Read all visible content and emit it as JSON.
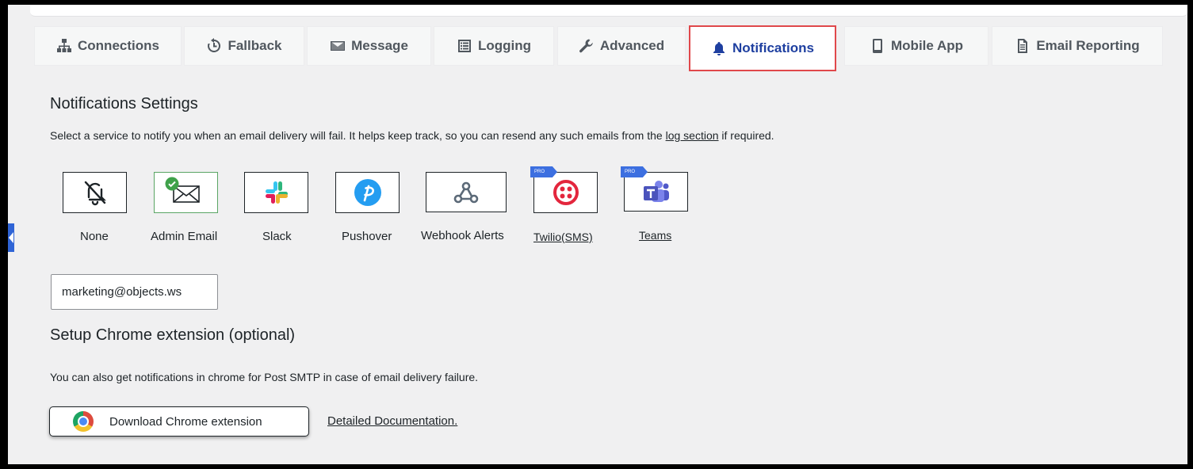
{
  "tabs": [
    {
      "label": "Connections",
      "icon": "sitemap-icon"
    },
    {
      "label": "Fallback",
      "icon": "history-icon"
    },
    {
      "label": "Message",
      "icon": "envelope-icon"
    },
    {
      "label": "Logging",
      "icon": "list-icon"
    },
    {
      "label": "Advanced",
      "icon": "wrench-icon"
    },
    {
      "label": "Notifications",
      "icon": "bell-icon",
      "active": true
    },
    {
      "label": "Mobile App",
      "icon": "smartphone-icon"
    },
    {
      "label": "Email Reporting",
      "icon": "document-icon"
    }
  ],
  "notifications": {
    "title": "Notifications Settings",
    "description_before": "Select a service to notify you when an email delivery will fail. It helps keep track, so you can resend any such emails from the ",
    "description_link": "log section",
    "description_after": " if required.",
    "services": [
      {
        "label": "None",
        "icon": "bell-off-icon"
      },
      {
        "label": "Admin Email",
        "icon": "envelope-icon",
        "selected": true
      },
      {
        "label": "Slack",
        "icon": "slack-icon"
      },
      {
        "label": "Pushover",
        "icon": "pushover-icon"
      },
      {
        "label": "Webhook Alerts",
        "icon": "webhook-icon"
      },
      {
        "label": "Twilio(SMS)",
        "icon": "twilio-icon",
        "pro": true
      },
      {
        "label": "Teams",
        "icon": "teams-icon",
        "pro": true
      }
    ],
    "pro_badge": "PRO",
    "email_value": "marketing@objects.ws"
  },
  "chrome": {
    "title": "Setup Chrome extension (optional)",
    "description": "You can also get notifications in chrome for Post SMTP in case of email delivery failure.",
    "button_label": "Download Chrome extension",
    "doc_link": "Detailed Documentation."
  },
  "colors": {
    "accent": "#1e3fa0",
    "highlight": "#e0484b",
    "selected": "#5aa564",
    "pro_badge": "#3c6fe0"
  }
}
